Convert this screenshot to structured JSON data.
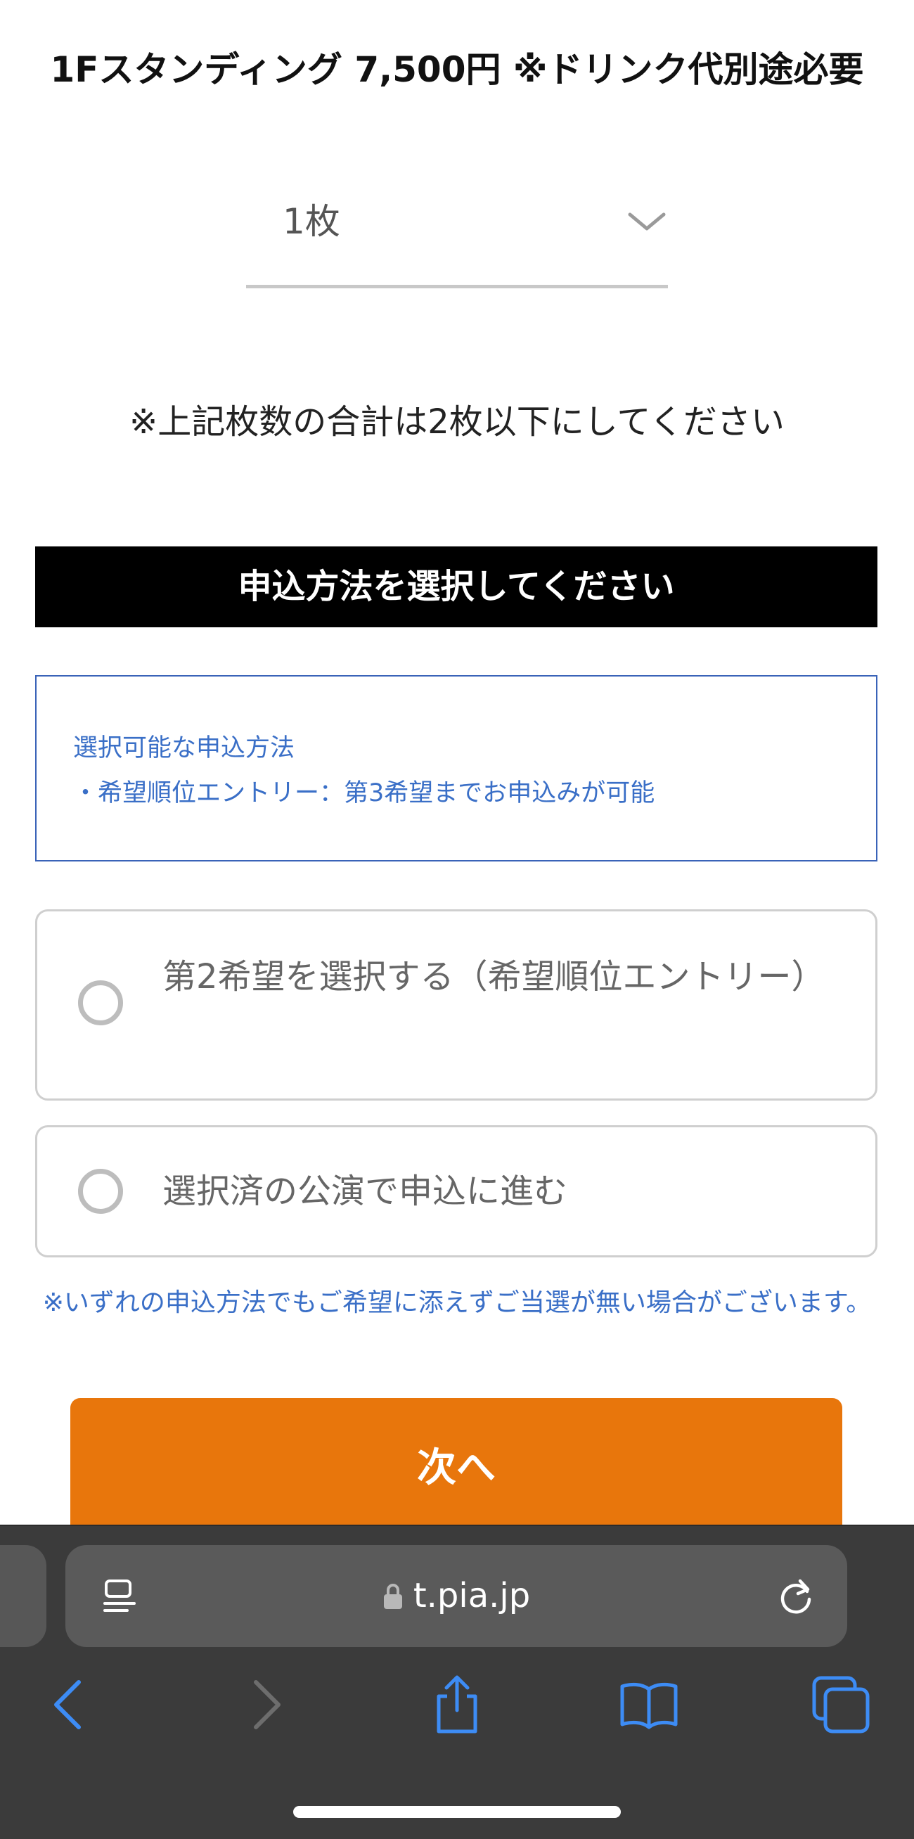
{
  "ticket": {
    "title": "1Fスタンディング 7,500円 ※ドリンク代別途必要"
  },
  "quantity_select": {
    "value": "1枚"
  },
  "quantity_note": "※上記枚数の合計は2枚以下にしてください",
  "method_section": {
    "header": "申込方法を選択してください",
    "info": {
      "heading": "選択可能な申込方法",
      "item": "・希望順位エントリー：第3希望までお申込みが可能"
    },
    "options": [
      {
        "label": "第2希望を選択する（希望順位エントリー）",
        "selected": false
      },
      {
        "label": "選択済の公演で申込に進む",
        "selected": false
      }
    ],
    "disclaimer": "※いずれの申込方法でもご希望に添えずご当選が無い場合がございます。"
  },
  "next_button": {
    "label": "次へ"
  },
  "browser": {
    "url": "t.pia.jp",
    "icons": {
      "reader": "reader-mode-icon",
      "lock": "lock-icon",
      "reload": "reload-icon",
      "back": "chevron-left-icon",
      "forward": "chevron-right-icon",
      "share": "share-icon",
      "bookmarks": "book-icon",
      "tabs": "tabs-icon"
    }
  },
  "colors": {
    "accent_orange": "#e8760c",
    "info_blue": "#3a6fc7",
    "ios_blue": "#3d8cf5",
    "header_black": "#000000",
    "toolbar_dark": "#3b3b3b"
  }
}
